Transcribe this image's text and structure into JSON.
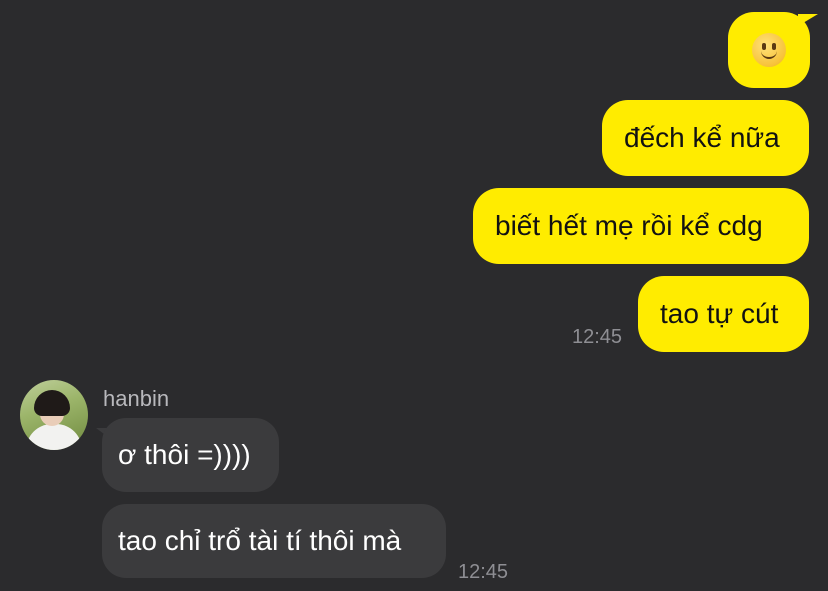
{
  "outgoing": {
    "emoji": "slightly-smiling-face",
    "messages": [
      "đếch kể nữa",
      "biết hết mẹ rồi kể cdg",
      "tao tự cút"
    ],
    "time": "12:45"
  },
  "incoming": {
    "sender": "hanbin",
    "avatar": "profile-photo",
    "messages": [
      "ơ thôi =))))",
      "tao chỉ trổ tài tí thôi mà"
    ],
    "time": "12:45"
  },
  "colors": {
    "background": "#2b2b2d",
    "outgoing_bubble": "#ffec00",
    "incoming_bubble": "#3b3b3d",
    "timestamp": "#8e8e93"
  }
}
